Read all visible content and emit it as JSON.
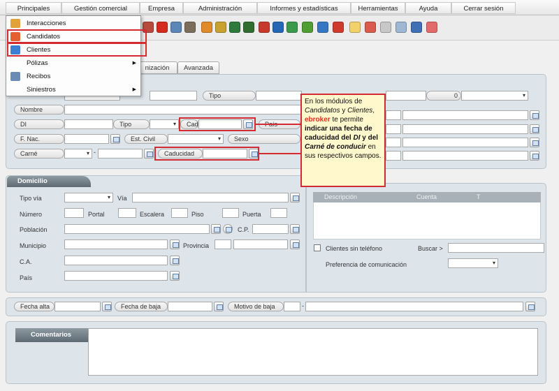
{
  "menu": {
    "items": [
      "Principales",
      "Gestión comercial",
      "Empresa",
      "Administración",
      "Informes y estadísticas",
      "Herramientas",
      "Ayuda",
      "Cerrar sesión"
    ]
  },
  "dropdown": {
    "items": [
      {
        "label": "Interacciones",
        "icon": "cube-icon",
        "color": "#e2a23a"
      },
      {
        "label": "Candidatos",
        "icon": "candidate-icon",
        "color": "#e56030"
      },
      {
        "label": "Clientes",
        "icon": "client-icon",
        "color": "#3c7fd1"
      },
      {
        "label": "Pólizas",
        "icon": "",
        "color": ""
      },
      {
        "label": "Recibos",
        "icon": "receipt-icon",
        "color": "#6a8bb3"
      },
      {
        "label": "Siniestros",
        "icon": "",
        "color": ""
      }
    ]
  },
  "tabs": {
    "partial": "nización",
    "advanced": "Avanzada"
  },
  "form": {
    "tipo": "Tipo",
    "zero": "0",
    "nombre": "Nombre",
    "di": "DI",
    "tipo2": "Tipo",
    "cad": "Cad.",
    "pais": "País",
    "fnac": "F. Nac.",
    "estcivil": "Est. Civil",
    "sexo": "Sexo",
    "carne": "Carné",
    "caducidad": "Caducidad",
    "dash": "-"
  },
  "callout": {
    "t1": "En los módulos de",
    "t2": "Candidatos",
    "t3": "y",
    "t4": "Clientes",
    "t5": ",",
    "t6": "ebroker",
    "t7": "te permite",
    "t8": "indicar una fecha de caducidad del",
    "t9": "DI",
    "t10": "y del",
    "t11": "Carné de conducir",
    "t12": "en sus respectivos campos."
  },
  "domicilio": {
    "title": "Domicilio",
    "tipovia": "Tipo vía",
    "via": "Vía",
    "numero": "Número",
    "portal": "Portal",
    "escalera": "Escalera",
    "piso": "Piso",
    "puerta": "Puerta",
    "poblacion": "Población",
    "cp": "C.P.",
    "municipio": "Municipio",
    "provincia": "Provincia",
    "ca": "C.A.",
    "pais": "País"
  },
  "grid": {
    "cols": [
      "Descripción",
      "Cuenta",
      "T"
    ]
  },
  "options": {
    "sin_telefono": "Clientes sin teléfono",
    "buscar": "Buscar >",
    "preferencia": "Preferencia de comunicación"
  },
  "bottom": {
    "alta": "Fecha alta",
    "baja": "Fecha de baja",
    "motivo": "Motivo de baja",
    "dash": "-"
  },
  "comentarios": {
    "title": "Comentarios"
  },
  "colors": {
    "highlight": "#d42a32",
    "panel": "#dde5ea",
    "header": "#6b7780",
    "callout_bg": "#fff8cd"
  }
}
